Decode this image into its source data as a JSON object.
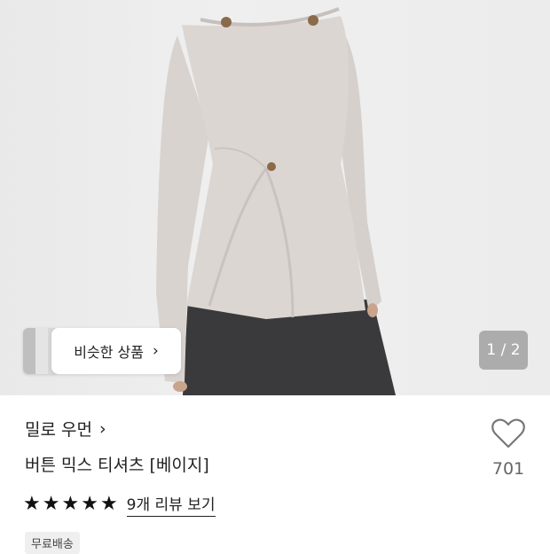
{
  "gallery": {
    "similar_label": "비슷한 상품",
    "pager": "1 / 2"
  },
  "product": {
    "brand": "밀로 우먼",
    "title": "버튼 믹스 티셔츠 [베이지]",
    "likes": "701",
    "rating": 5,
    "review_link": "9개 리뷰 보기",
    "shipping_tag": "무료배송"
  },
  "icons": {
    "brand_chevron": "chevron-right-icon",
    "similar_chevron": "chevron-right-icon",
    "like": "heart-outline-icon",
    "star": "star-filled-icon"
  },
  "colors": {
    "garment": "#d8d2cf",
    "skirt": "#3b3b3d",
    "background": "#ebebeb"
  }
}
